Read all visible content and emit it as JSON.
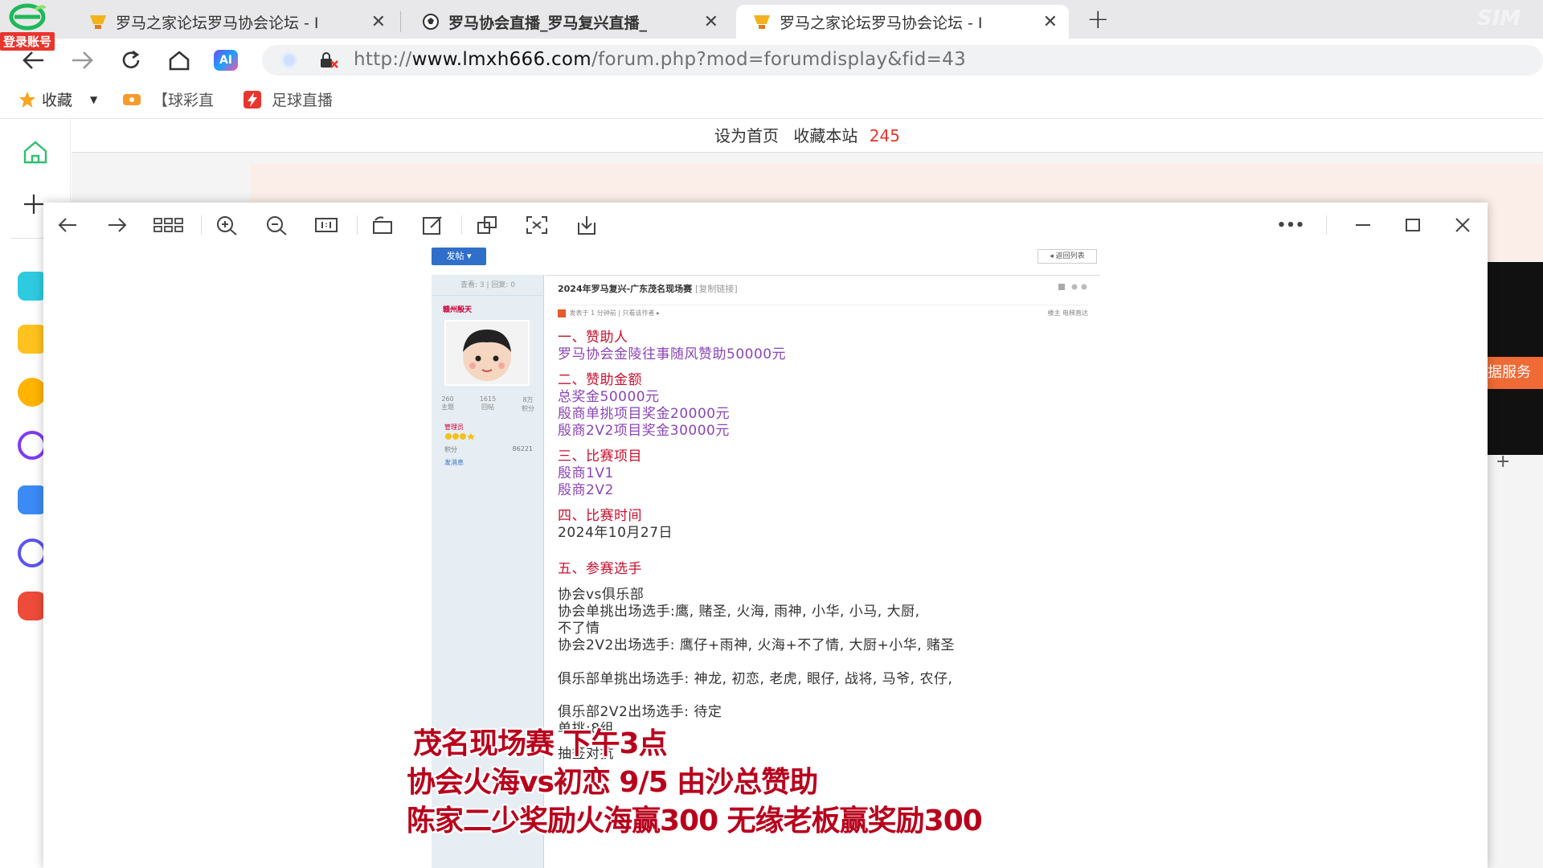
{
  "browser": {
    "login_badge": "登录账号",
    "tabs": [
      {
        "title": "罗马之家论坛罗马协会论坛 - I",
        "active": false
      },
      {
        "title": "罗马协会直播_罗马复兴直播_",
        "active": false
      },
      {
        "title": "罗马之家论坛罗马协会论坛 - I",
        "active": true
      }
    ],
    "new_tab": "+",
    "close_glyph": "✕",
    "ai_label": "AI",
    "url_prefix": "http://",
    "url_host": "www.lmxh666.com",
    "url_path": "/forum.php?mod=forumdisplay&fid=43",
    "bookmarks": [
      {
        "label": "收藏",
        "icon": "star-icon"
      },
      {
        "label": "【球彩直",
        "icon": "ticket-icon"
      },
      {
        "label": "足球直播",
        "icon": "lightning-icon"
      }
    ],
    "dropdown_glyph": "▼"
  },
  "webpage": {
    "set_home": "设为首页",
    "bookmark_site": "收藏本站",
    "count": "245",
    "right_service": "据服务",
    "right_plus": "+"
  },
  "viewer": {
    "more_glyph": "•••"
  },
  "post": {
    "post_button": "发帖 ▾",
    "back_button": "◂ 返回列表",
    "left_stats": "查看: 3 | 回复: 0",
    "username": "赣州殷天",
    "user_stats": [
      {
        "value": "260",
        "label": "主题"
      },
      {
        "value": "1615",
        "label": "回帖"
      },
      {
        "value": "8万",
        "label": "积分"
      }
    ],
    "user_role": "管理员",
    "user_points_label": "积分",
    "user_points_value": "86221",
    "user_msg": "发消息",
    "title": "2024年罗马复兴-广东茂名现场赛",
    "title_link": "[复制链接]",
    "meta_left": "发表于 1 分钟前   |   只看该作者  ▸",
    "meta_right": "楼主    电梯直达",
    "lines": [
      {
        "text": "一、赞助人",
        "cls": "red"
      },
      {
        "text": "罗马协会金陵往事随风赞助50000元",
        "cls": "purple"
      },
      {
        "text": "二、赞助金额",
        "cls": "red"
      },
      {
        "text": "总奖金50000元",
        "cls": "purple"
      },
      {
        "text": "殷商单挑项目奖金20000元",
        "cls": "purple"
      },
      {
        "text": "殷商2V2项目奖金30000元",
        "cls": "purple"
      },
      {
        "text": "三、比赛项目",
        "cls": "red"
      },
      {
        "text": "殷商1V1",
        "cls": "purple"
      },
      {
        "text": "殷商2V2",
        "cls": "purple"
      },
      {
        "text": "四、比赛时间",
        "cls": "red"
      },
      {
        "text": "2024年10月27日",
        "cls": "dark"
      },
      {
        "text": "五、参赛选手",
        "cls": "red"
      },
      {
        "text": "协会vs俱乐部",
        "cls": "dark"
      },
      {
        "text": "协会单挑出场选手:鹰, 赌圣, 火海, 雨神, 小华, 小马, 大厨,",
        "cls": "dark"
      },
      {
        "text": "不了情",
        "cls": "dark"
      },
      {
        "text": "协会2V2出场选手: 鹰仔+雨神, 火海+不了情, 大厨+小华, 赌圣",
        "cls": "dark"
      },
      {
        "text": "俱乐部单挑出场选手: 神龙, 初恋, 老虎, 眼仔, 战将, 马爷, 农仔,",
        "cls": "dark"
      },
      {
        "text": "俱乐部2V2出场选手: 待定",
        "cls": "dark"
      },
      {
        "text": "单挑:8组",
        "cls": "dark"
      },
      {
        "text": "抽签对抗",
        "cls": "dark"
      }
    ]
  },
  "captions": [
    "茂名现场赛 下午3点",
    "协会火海vs初恋 9/5 由沙总赞助",
    "陈家二少奖励火海赢300 无缘老板赢奖励300"
  ]
}
